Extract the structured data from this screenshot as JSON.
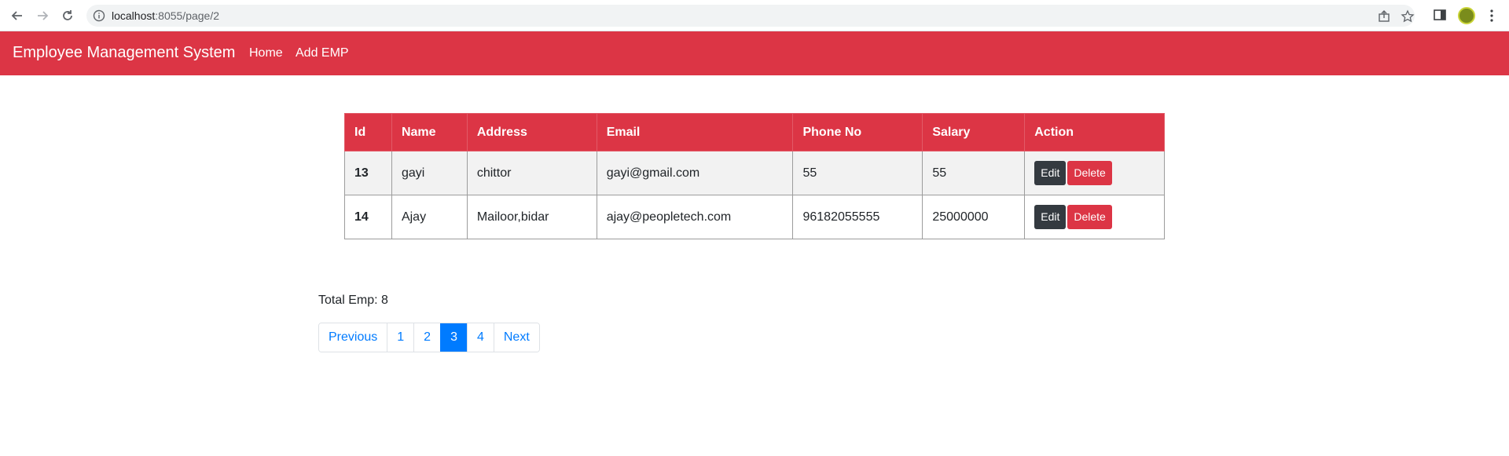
{
  "browser": {
    "url_host": "localhost",
    "url_path": ":8055/page/2"
  },
  "navbar": {
    "brand": "Employee Management System",
    "links": [
      "Home",
      "Add EMP"
    ]
  },
  "table": {
    "headers": [
      "Id",
      "Name",
      "Address",
      "Email",
      "Phone No",
      "Salary",
      "Action"
    ],
    "rows": [
      {
        "id": "13",
        "name": "gayi",
        "address": "chittor",
        "email": "gayi@gmail.com",
        "phone": "55",
        "salary": "55"
      },
      {
        "id": "14",
        "name": "Ajay",
        "address": "Mailoor,bidar",
        "email": "ajay@peopletech.com",
        "phone": "96182055555",
        "salary": "25000000"
      }
    ],
    "edit_label": "Edit",
    "delete_label": "Delete"
  },
  "summary": {
    "total_text": "Total Emp: 8"
  },
  "pagination": {
    "previous": "Previous",
    "pages": [
      "1",
      "2",
      "3",
      "4"
    ],
    "active_page": "3",
    "next": "Next"
  },
  "colors": {
    "brand_red": "#dc3545",
    "primary_blue": "#007bff",
    "dark_button": "#343a40"
  }
}
